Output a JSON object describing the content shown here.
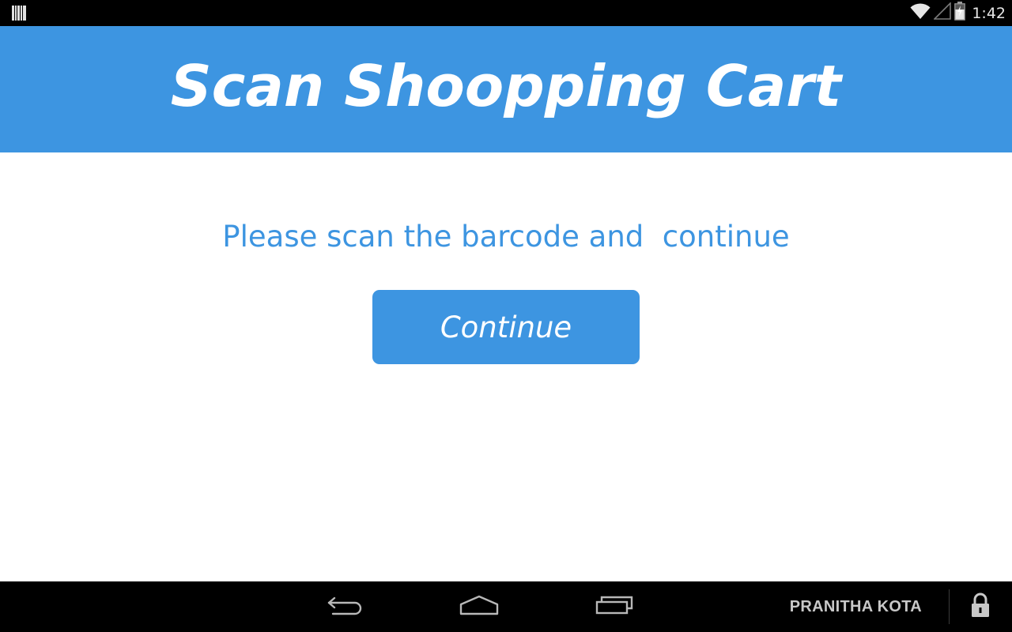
{
  "status_bar": {
    "time": "1:42",
    "left_icon": "barcode-notification-icon",
    "wifi_icon": "wifi-icon",
    "signal_icon": "cell-signal-icon",
    "battery_icon": "battery-charging-icon"
  },
  "header": {
    "title": "Scan Shoopping Cart"
  },
  "main": {
    "instruction": "Please scan the barcode and  continue",
    "continue_label": "Continue"
  },
  "nav_bar": {
    "back_icon": "back-icon",
    "home_icon": "home-icon",
    "recents_icon": "recent-apps-icon",
    "user_name": "PRANITHA KOTA",
    "lock_icon": "lock-icon"
  },
  "colors": {
    "accent": "#3d95e1",
    "status_bar": "#000000",
    "nav_bar": "#000000",
    "background": "#ffffff"
  }
}
